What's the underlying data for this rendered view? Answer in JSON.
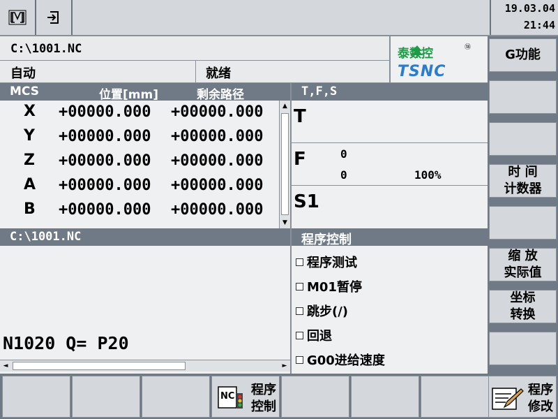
{
  "topbar": {
    "mode_icon": "M-mode-icon",
    "exit_icon": "exit-arrow-icon",
    "date": "19.03.04",
    "time": "21:44"
  },
  "program": {
    "path": "C:\\1001.NC"
  },
  "status": {
    "mode": "自动",
    "state": "就绪"
  },
  "logo": {
    "name": "泰数控",
    "sub": "TSNC",
    "mark": "⑱"
  },
  "mcs": {
    "header": {
      "frame": "MCS",
      "pos": "位置[mm]",
      "remain": "剩余路径"
    },
    "axes": [
      {
        "axis": "X",
        "pos": "+00000.000",
        "remain": "+00000.000"
      },
      {
        "axis": "Y",
        "pos": "+00000.000",
        "remain": "+00000.000"
      },
      {
        "axis": "Z",
        "pos": "+00000.000",
        "remain": "+00000.000"
      },
      {
        "axis": "A",
        "pos": "+00000.000",
        "remain": "+00000.000"
      },
      {
        "axis": "B",
        "pos": "+00000.000",
        "remain": "+00000.000"
      }
    ]
  },
  "tfs": {
    "header": "T,F,S",
    "t_label": "T",
    "f_label": "F",
    "f_value": "0",
    "f_actual": "0",
    "f_override": "100%",
    "s_label": "S1"
  },
  "program_window": {
    "path": "C:\\1001.NC",
    "current_line": "N1020 Q= P20"
  },
  "program_control": {
    "title": "程序控制",
    "options": [
      "程序测试",
      "M01暂停",
      "跳步(/)",
      "回退",
      "G00进给速度"
    ]
  },
  "vsoftkeys": {
    "k1": "G功能",
    "k5a": "时 间",
    "k5b": "计数器",
    "k7a": "缩 放",
    "k7b": "实际值",
    "k8a": "坐标",
    "k8b": "转换"
  },
  "hsoftkeys": {
    "k4a": "程序",
    "k4b": "控制",
    "k8a": "程序",
    "k8b": "修改"
  },
  "colors": {
    "header": "#6f7a86",
    "panel": "#eef0f2",
    "key": "#d4d8dc"
  }
}
